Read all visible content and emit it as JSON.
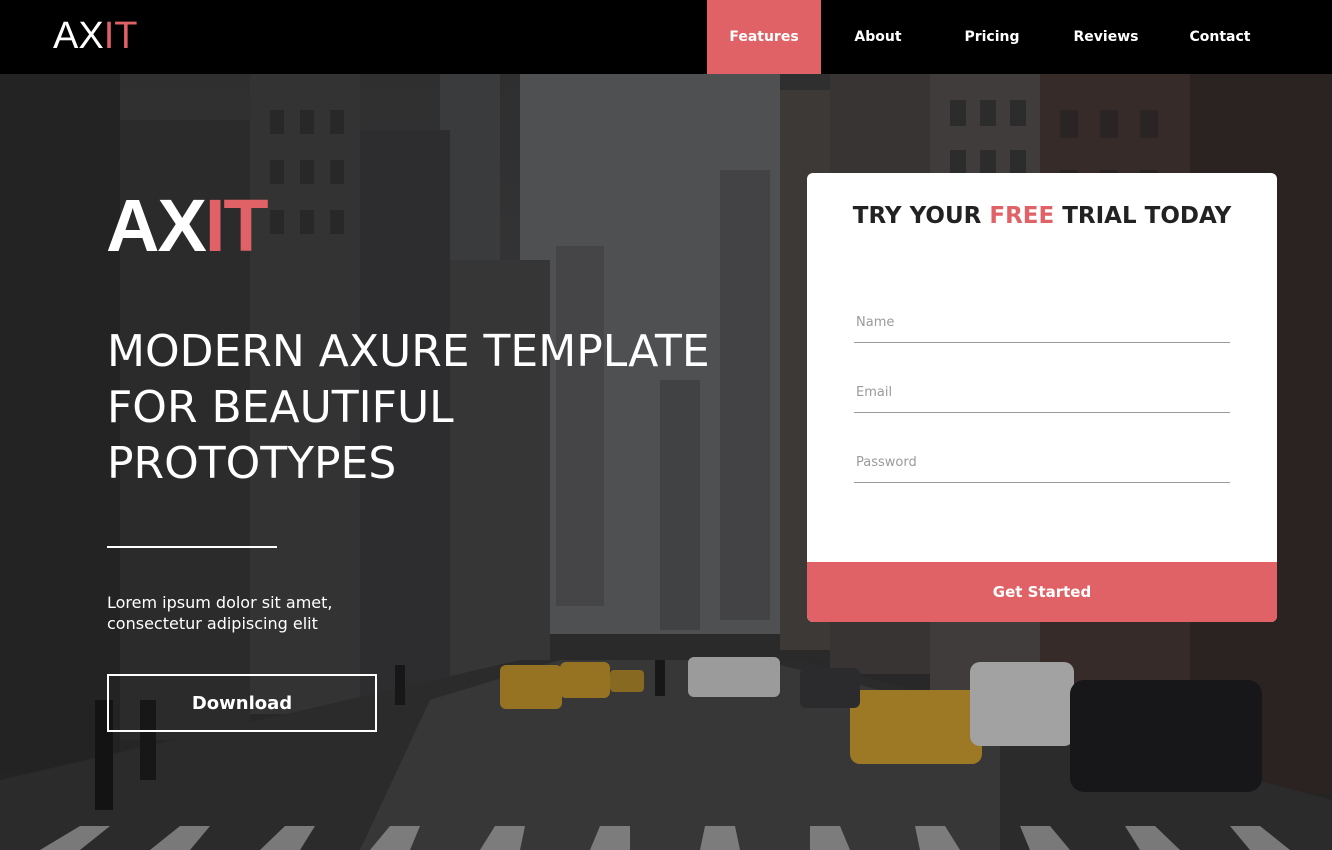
{
  "brand": {
    "logo_prefix": "AX",
    "logo_accent": "IT"
  },
  "nav": {
    "items": [
      {
        "label": "Features",
        "active": true
      },
      {
        "label": "About",
        "active": false
      },
      {
        "label": "Pricing",
        "active": false
      },
      {
        "label": "Reviews",
        "active": false
      },
      {
        "label": "Contact",
        "active": false
      }
    ]
  },
  "hero": {
    "brand_prefix": "AX",
    "brand_accent": "IT",
    "headline_line1": "MODERN AXURE TEMPLATE",
    "headline_line2": "FOR BEAUTIFUL",
    "headline_line3": "PROTOTYPES",
    "lede_line1": "Lorem ipsum dolor sit amet,",
    "lede_line2": "consectetur adipiscing elit",
    "download_label": "Download"
  },
  "signup": {
    "title_before": "TRY YOUR ",
    "title_accent": "FREE",
    "title_after": " TRIAL TODAY",
    "name_placeholder": "Name",
    "name_value": "",
    "email_placeholder": "Email",
    "email_value": "",
    "password_placeholder": "Password",
    "password_value": "",
    "submit_label": "Get Started"
  },
  "colors": {
    "accent": "#e06266",
    "topbar": "#000000",
    "text_light": "#ffffff",
    "card_bg": "#ffffff"
  },
  "icons": {
    "background": "city-street-photo"
  }
}
